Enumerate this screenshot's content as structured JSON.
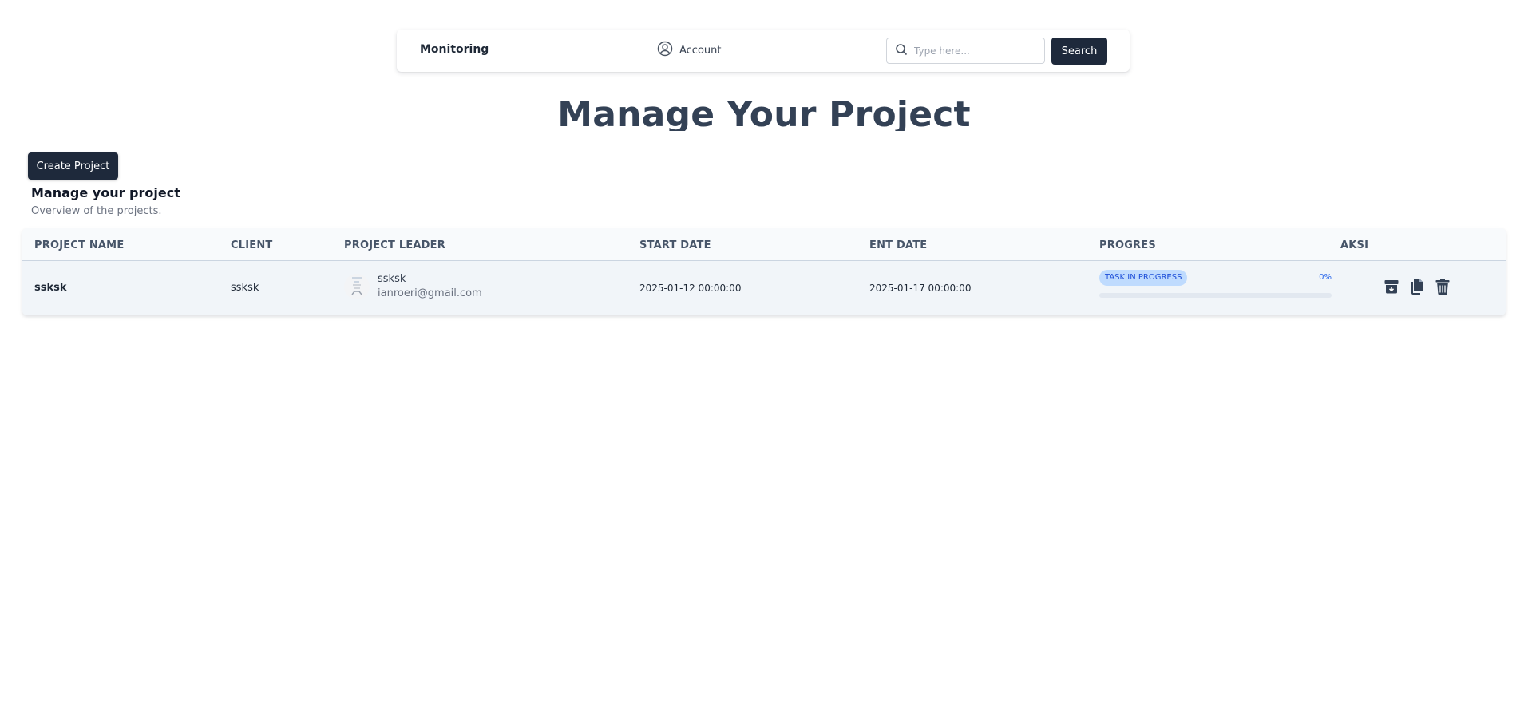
{
  "navbar": {
    "brand": "Monitoring",
    "account_label": "Account",
    "search_placeholder": "Type here...",
    "search_button": "Search"
  },
  "page": {
    "title": "Manage Your Project",
    "create_button": "Create Project",
    "section_title": "Manage your project",
    "section_subtitle": "Overview of the projects."
  },
  "table": {
    "headers": [
      "PROJECT NAME",
      "CLIENT",
      "PROJECT LEADER",
      "START DATE",
      "ENT DATE",
      "PROGRES",
      "AKSI"
    ],
    "rows": [
      {
        "project_name": "ssksk",
        "client": "ssksk",
        "leader_name": "ssksk",
        "leader_email": "ianroeri@gmail.com",
        "start_date": "2025-01-12 00:00:00",
        "end_date": "2025-01-17 00:00:00",
        "status": "TASK IN PROGRESS",
        "progress_label": "0%",
        "progress_percent": 0
      }
    ]
  },
  "colors": {
    "primary": "#1e293b",
    "badge_bg": "#bfdbfe",
    "badge_text": "#1d4ed8",
    "progress": "#2563eb"
  },
  "icons": {
    "account": "user-circle-icon",
    "search": "search-icon",
    "archive": "archive-icon",
    "copy": "copy-icon",
    "delete": "trash-icon"
  }
}
